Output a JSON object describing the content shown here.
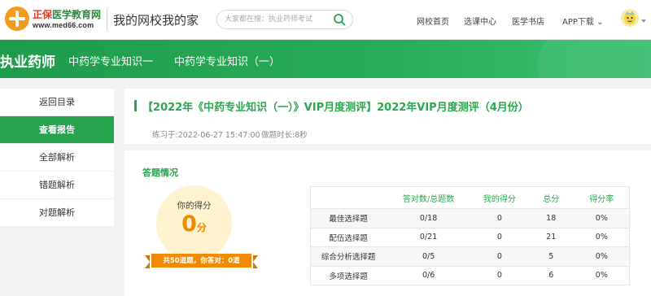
{
  "header": {
    "logo": {
      "brand": "正保",
      "name": "医学教育网",
      "url": "www.med66.com"
    },
    "slogan": "我的网校我的家",
    "search": {
      "placeholder": "大家都在搜：执业药师考试"
    },
    "nav": [
      "网校首页",
      "选课中心",
      "医学书店",
      "APP下载 ⌄"
    ]
  },
  "banner": {
    "title": "执业药师",
    "subtitles": [
      "中药学专业知识一",
      "中药学专业知识（一）"
    ]
  },
  "sidebar": {
    "items": [
      {
        "label": "返回目录",
        "active": false
      },
      {
        "label": "查看报告",
        "active": true
      },
      {
        "label": "全部解析",
        "active": false
      },
      {
        "label": "错题解析",
        "active": false
      },
      {
        "label": "对题解析",
        "active": false
      }
    ]
  },
  "exam": {
    "title": "【2022年《中药专业知识（一）》VIP月度测评】2022年VIP月度测评（4月份）",
    "practice_time": "练习于:2022-06-27 15:47:00",
    "duration": "做题时长:8秒"
  },
  "result": {
    "heading": "答题情况",
    "score_label": "你的得分",
    "score": "0",
    "score_unit": "分",
    "summary": "共50道题，你答对：0道"
  },
  "stats": {
    "columns": [
      "",
      "答对数/总题数",
      "我的得分",
      "总分",
      "得分率"
    ],
    "rows": [
      [
        "最佳选择题",
        "0/18",
        "0",
        "18",
        "0%"
      ],
      [
        "配伍选择题",
        "0/21",
        "0",
        "21",
        "0%"
      ],
      [
        "综合分析选择题",
        "0/5",
        "0",
        "5",
        "0%"
      ],
      [
        "多项选择题",
        "0/6",
        "0",
        "6",
        "0%"
      ]
    ]
  },
  "colors": {
    "brand_green": "#27a24d",
    "accent_orange": "#f08a00",
    "score_bg": "#fef2cf"
  },
  "icons": {
    "search": "search-icon",
    "avatar": "user-avatar",
    "dropdown": "chevron-down-icon"
  }
}
